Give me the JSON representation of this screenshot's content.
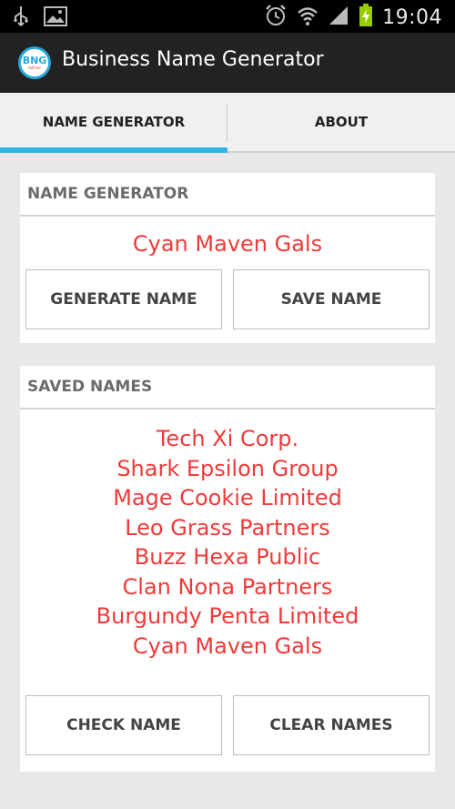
{
  "status_bar": {
    "time": "19:04",
    "left_icons": [
      "usb-icon",
      "image-icon"
    ],
    "right_icons": [
      "alarm-icon",
      "wifi-icon",
      "signal-icon",
      "battery-charging-icon"
    ]
  },
  "action_bar": {
    "logo_text": "BNG",
    "logo_subtext": "AdFree",
    "title": "Business Name Generator"
  },
  "tabs": [
    {
      "label": "NAME GENERATOR",
      "active": true
    },
    {
      "label": "ABOUT",
      "active": false
    }
  ],
  "generator": {
    "header": "NAME GENERATOR",
    "current_name": "Cyan Maven Gals",
    "generate_label": "GENERATE NAME",
    "save_label": "SAVE NAME"
  },
  "saved": {
    "header": "SAVED NAMES",
    "names": [
      "Tech Xi Corp.",
      "Shark Epsilon Group",
      "Mage Cookie Limited",
      "Leo Grass Partners",
      "Buzz Hexa Public",
      "Clan Nona Partners",
      "Burgundy Penta Limited",
      "Cyan Maven Gals"
    ],
    "check_label": "CHECK NAME",
    "clear_label": "CLEAR NAMES"
  },
  "colors": {
    "accent": "#33b5e5",
    "name_text": "#f03a3a",
    "action_bar": "#222222"
  }
}
